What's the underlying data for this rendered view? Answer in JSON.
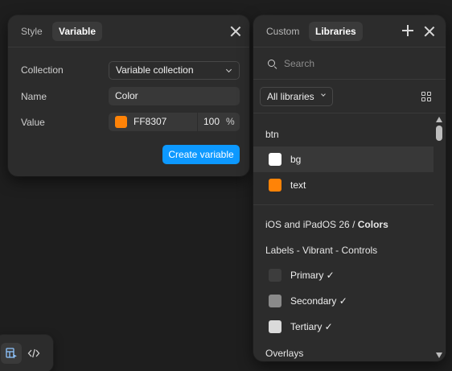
{
  "variable_panel": {
    "tabs": [
      {
        "label": "Style",
        "active": false
      },
      {
        "label": "Variable",
        "active": true
      }
    ],
    "rows": {
      "collection": {
        "label": "Collection",
        "value": "Variable collection"
      },
      "name": {
        "label": "Name",
        "value": "Color"
      },
      "value": {
        "label": "Value",
        "hex": "FF8307",
        "opacity": "100",
        "percent_sign": "%",
        "swatch_color": "#FF8307"
      }
    },
    "create_button": "Create variable",
    "accent_color": "#0D99FF"
  },
  "libraries_panel": {
    "tabs": [
      {
        "label": "Custom",
        "active": false
      },
      {
        "label": "Libraries",
        "active": true
      }
    ],
    "search": {
      "placeholder": "Search",
      "value": ""
    },
    "library_filter": "All libraries",
    "groups": [
      {
        "title": "btn",
        "items": [
          {
            "label": "bg",
            "color": "#FFFFFF",
            "selected": true
          },
          {
            "label": "text",
            "color": "#FF8307",
            "selected": false
          }
        ]
      },
      {
        "title_prefix": "iOS and iPadOS 26 / ",
        "title_strong": "Colors"
      },
      {
        "title": "Labels - Vibrant - Controls",
        "items": [
          {
            "label": "Primary ✓",
            "color": "#3D3D3D",
            "selected": false
          },
          {
            "label": "Secondary ✓",
            "color": "#8A8A8A",
            "selected": false
          },
          {
            "label": "Tertiary ✓",
            "color": "#DADADA",
            "selected": false
          }
        ]
      },
      {
        "title": "Overlays"
      }
    ]
  },
  "toolbar": {
    "buttons": [
      {
        "icon": "design-mode-icon",
        "active": true
      },
      {
        "icon": "code-icon",
        "active": false
      }
    ]
  }
}
